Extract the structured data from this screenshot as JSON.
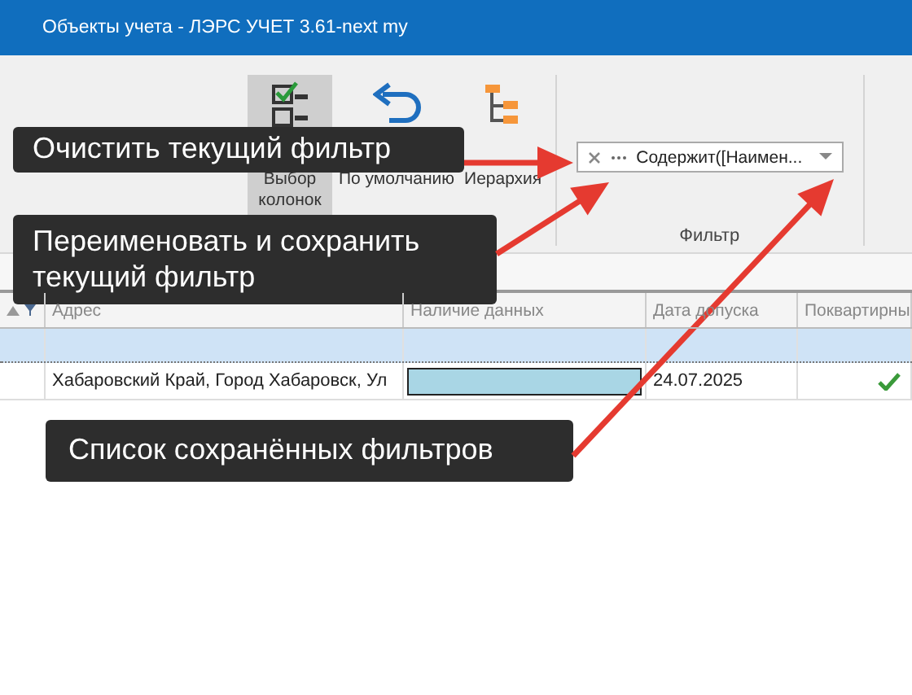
{
  "window": {
    "title": "Объекты учета - ЛЭРС УЧЕТ 3.61-next my"
  },
  "ribbon": {
    "buttons": [
      {
        "label": "Выбор колонок",
        "kind": "columns",
        "selected": true
      },
      {
        "label": "По умолчанию",
        "kind": "undo",
        "selected": false
      },
      {
        "label": "Иерархия",
        "kind": "hierarchy",
        "selected": false
      }
    ],
    "filter_group": {
      "label": "Фильтр",
      "filter_combo": {
        "value": "Содержит([Наимен..."
      }
    }
  },
  "table": {
    "columns": [
      "Адрес",
      "Наличие данных",
      "Дата допуска",
      "Поквартирны"
    ],
    "rows": [
      {
        "address": "Хабаровский Край, Город Хабаровск, Ул",
        "level": 1,
        "date": "24.07.2025",
        "checked": true
      }
    ]
  },
  "callouts": [
    {
      "text": "Очистить текущий фильтр"
    },
    {
      "text": "Переименовать и сохранить текущий фильтр"
    },
    {
      "text": "Список сохранённых фильтров"
    }
  ]
}
